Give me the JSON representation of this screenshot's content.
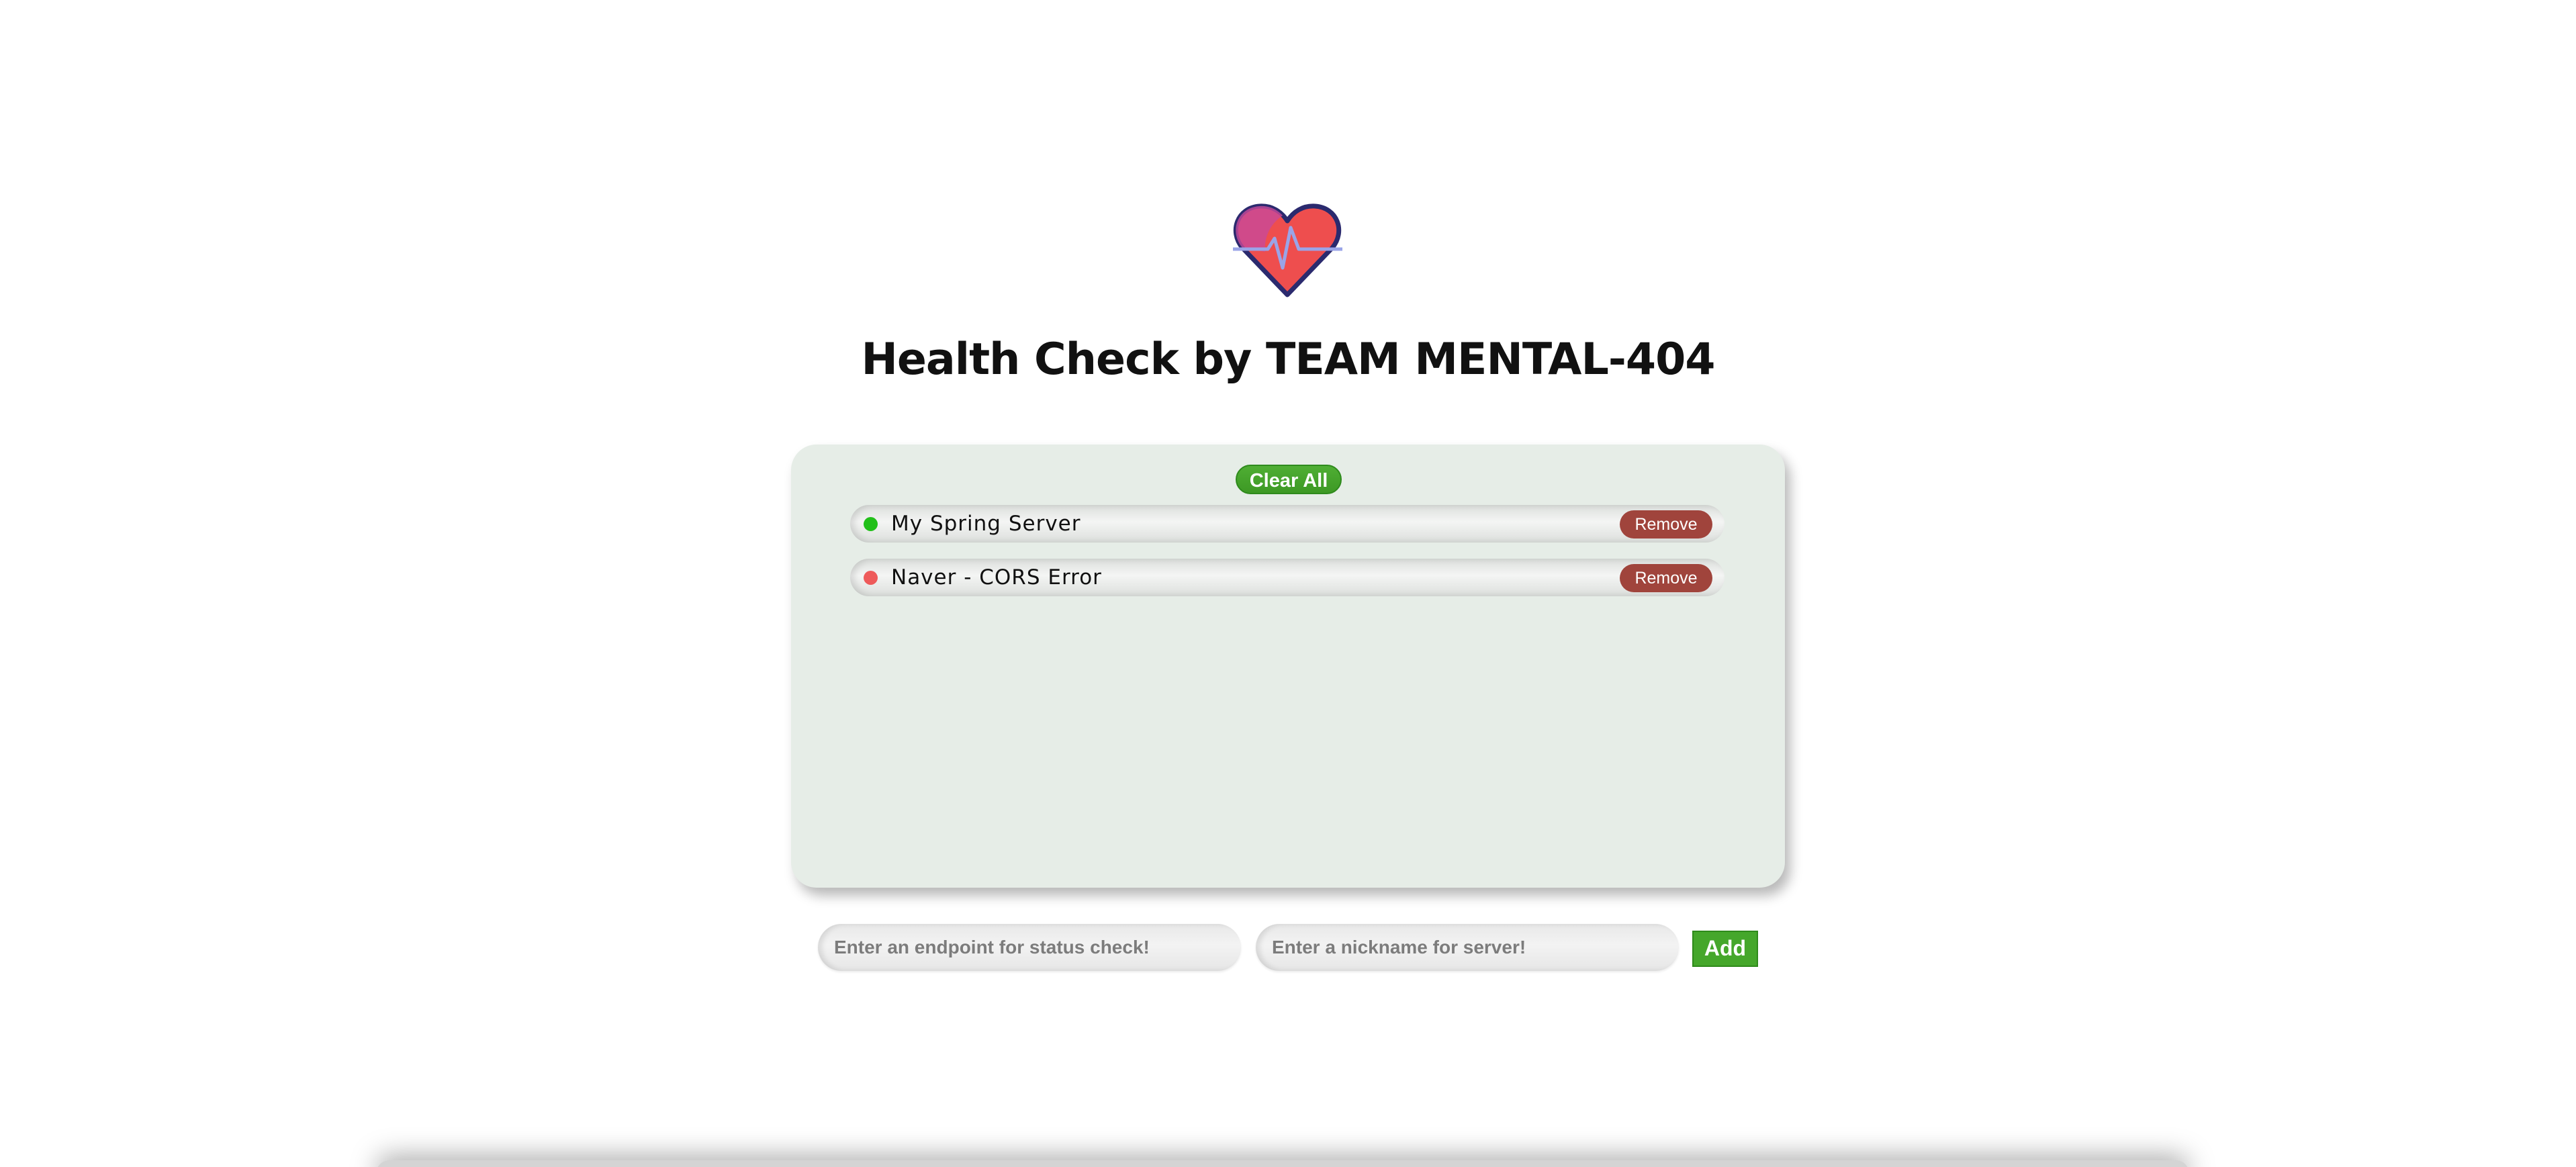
{
  "header": {
    "logo_icon": "heart-pulse-icon",
    "title": "Health Check by TEAM MENTAL-404"
  },
  "panel": {
    "clear_all_label": "Clear All",
    "servers": [
      {
        "name": "My Spring Server",
        "status": "healthy",
        "status_color": "#22c01a",
        "remove_label": "Remove"
      },
      {
        "name": "Naver - CORS Error",
        "status": "error",
        "status_color": "#ee5a5a",
        "remove_label": "Remove"
      }
    ]
  },
  "form": {
    "endpoint_placeholder": "Enter an endpoint for status check!",
    "nickname_placeholder": "Enter a nickname for server!",
    "add_label": "Add"
  },
  "colors": {
    "panel_bg": "#e6ede7",
    "add_green": "#45a72b",
    "remove_red": "#a0443c",
    "heart_red": "#ee4e4e",
    "heart_outline": "#2b2a6e"
  }
}
